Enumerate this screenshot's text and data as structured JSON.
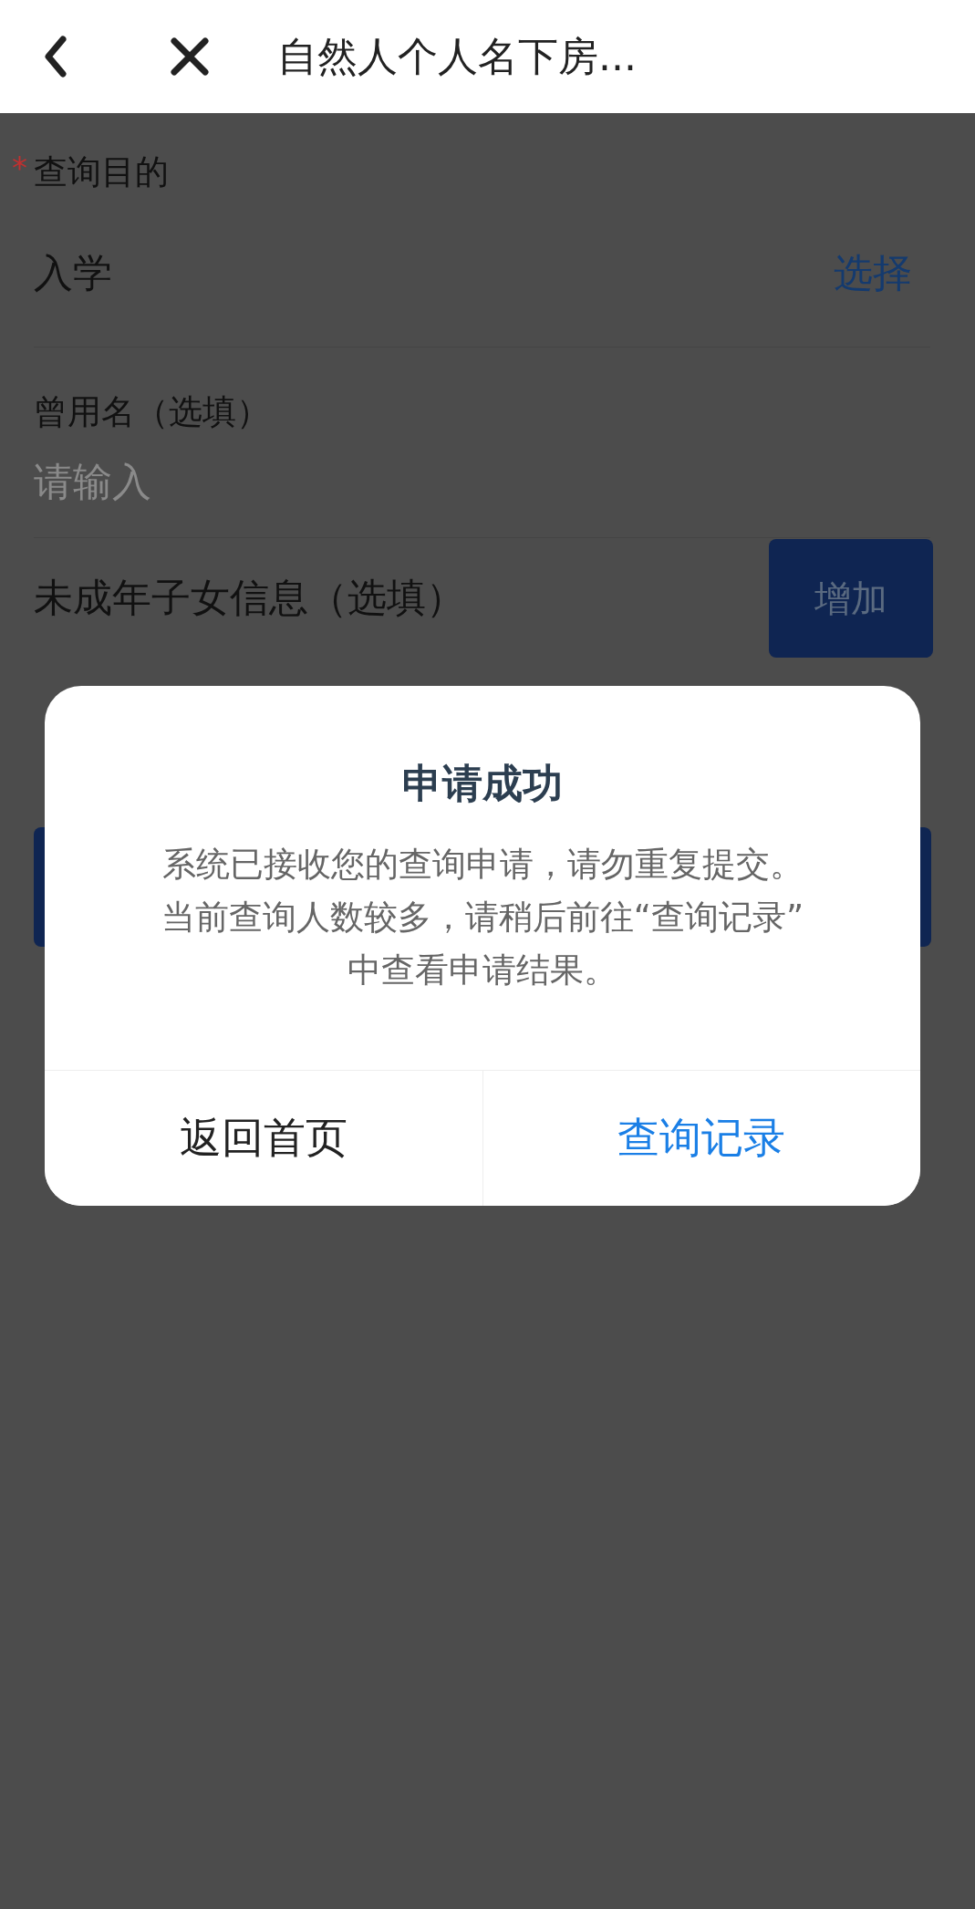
{
  "header": {
    "title": "自然人个人名下房..."
  },
  "form": {
    "purpose": {
      "required_mark": "*",
      "label": "查询目的",
      "value": "入学",
      "action": "选择"
    },
    "former_name": {
      "label": "曾用名（选填）",
      "placeholder": "请输入"
    },
    "children": {
      "label": "未成年子女信息（选填）",
      "button": "增加"
    }
  },
  "dialog": {
    "title": "申请成功",
    "message_lines": [
      "系统已接收您的查询申请，请勿重复提交。",
      "当前查询人数较多，请稍后前往“查询记录”",
      "中查看申请结果。"
    ],
    "buttons": [
      {
        "label": "返回首页",
        "kind": "secondary"
      },
      {
        "label": "查询记录",
        "kind": "primary"
      }
    ]
  }
}
